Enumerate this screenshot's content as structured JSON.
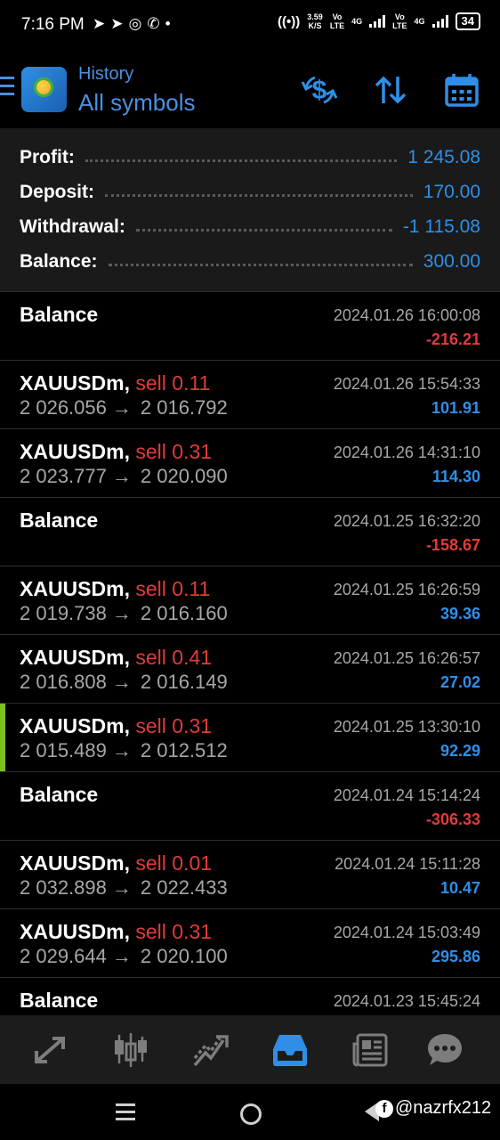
{
  "status_bar": {
    "time": "7:16 PM",
    "net_speed_top": "3.59",
    "net_speed_bottom": "K/S",
    "sim1_top": "Vo",
    "sim1_bottom": "LTE",
    "sim1_gen": "4G",
    "sim2_top": "Vo",
    "sim2_bottom": "LTE",
    "sim2_gen": "4G",
    "battery": "34"
  },
  "header": {
    "subtitle": "History",
    "title": "All symbols"
  },
  "summary": {
    "profit_label": "Profit:",
    "profit_value": "1 245.08",
    "deposit_label": "Deposit:",
    "deposit_value": "170.00",
    "withdrawal_label": "Withdrawal:",
    "withdrawal_value": "-1 115.08",
    "balance_label": "Balance:",
    "balance_value": "300.00"
  },
  "rows": [
    {
      "title": "Balance",
      "time": "2024.01.26 16:00:08",
      "amount": "-216.21"
    },
    {
      "symbol": "XAUUSDm,",
      "side": "sell 0.11",
      "open": "2 026.056",
      "close": "2 016.792",
      "time": "2024.01.26 15:54:33",
      "amount": "101.91"
    },
    {
      "symbol": "XAUUSDm,",
      "side": "sell 0.31",
      "open": "2 023.777",
      "close": "2 020.090",
      "time": "2024.01.26 14:31:10",
      "amount": "114.30"
    },
    {
      "title": "Balance",
      "time": "2024.01.25 16:32:20",
      "amount": "-158.67"
    },
    {
      "symbol": "XAUUSDm,",
      "side": "sell 0.11",
      "open": "2 019.738",
      "close": "2 016.160",
      "time": "2024.01.25 16:26:59",
      "amount": "39.36"
    },
    {
      "symbol": "XAUUSDm,",
      "side": "sell 0.41",
      "open": "2 016.808",
      "close": "2 016.149",
      "time": "2024.01.25 16:26:57",
      "amount": "27.02"
    },
    {
      "symbol": "XAUUSDm,",
      "side": "sell 0.31",
      "open": "2 015.489",
      "close": "2 012.512",
      "time": "2024.01.25 13:30:10",
      "amount": "92.29"
    },
    {
      "title": "Balance",
      "time": "2024.01.24 15:14:24",
      "amount": "-306.33"
    },
    {
      "symbol": "XAUUSDm,",
      "side": "sell 0.01",
      "open": "2 032.898",
      "close": "2 022.433",
      "time": "2024.01.24 15:11:28",
      "amount": "10.47"
    },
    {
      "symbol": "XAUUSDm,",
      "side": "sell 0.31",
      "open": "2 029.644",
      "close": "2 020.100",
      "time": "2024.01.24 15:03:49",
      "amount": "295.86"
    },
    {
      "title": "Balance",
      "time": "2024.01.23 15:45:24",
      "amount": ""
    }
  ],
  "arrow_glyph": "→",
  "bottom_nav": [
    "quotes-icon",
    "chart-icon",
    "trade-icon",
    "history-icon",
    "news-icon",
    "messages-icon"
  ],
  "watermark": "@nazrfx212",
  "colors": {
    "accent": "#2f8fe8",
    "loss": "#e23b3b",
    "highlight_bar": "#7cc120"
  }
}
